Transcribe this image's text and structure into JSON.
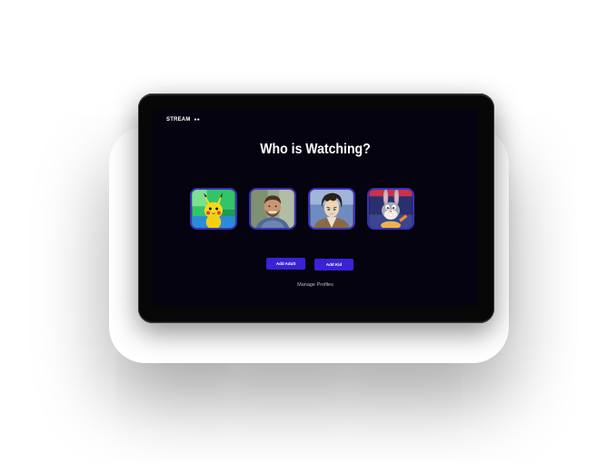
{
  "app": {
    "logo_text": "STREAM",
    "logo_icon": "eyes-icon"
  },
  "main": {
    "title": "Who is Watching?",
    "profiles": [
      {
        "name": "pikachu",
        "icon": "pikachu-avatar"
      },
      {
        "name": "man",
        "icon": "man-avatar"
      },
      {
        "name": "anime-boy",
        "icon": "anime-avatar"
      },
      {
        "name": "bugs-bunny",
        "icon": "bunny-avatar"
      }
    ],
    "add_adult_label": "Add Adult",
    "add_kid_label": "Add Kid",
    "manage_label": "Manage Profiles"
  },
  "colors": {
    "screen_bg": "#04030f",
    "accent": "#3a22d6",
    "profile_border": "#3d2fb8"
  }
}
